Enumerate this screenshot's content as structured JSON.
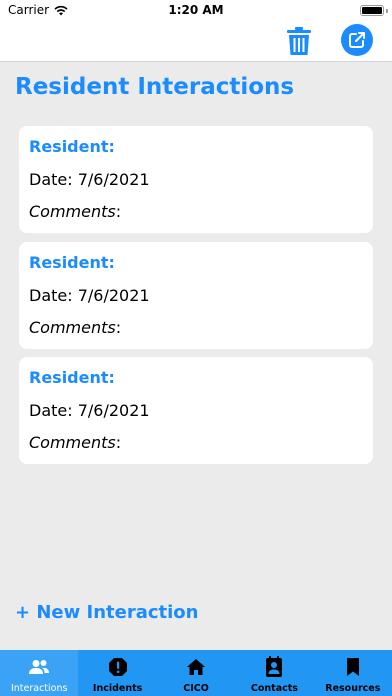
{
  "status_bar": {
    "carrier": "Carrier",
    "time": "1:20 AM"
  },
  "nav": {
    "trash_icon": "trash-icon",
    "share_icon": "share-edit-icon"
  },
  "page": {
    "title": "Resident Interactions"
  },
  "interactions": [
    {
      "resident_label": "Resident:",
      "date_label": "Date: 7/6/2021",
      "comments_label": "Comments",
      "comments_suffix": ":"
    },
    {
      "resident_label": "Resident:",
      "date_label": "Date: 7/6/2021",
      "comments_label": "Comments",
      "comments_suffix": ":"
    },
    {
      "resident_label": "Resident:",
      "date_label": "Date: 7/6/2021",
      "comments_label": "Comments",
      "comments_suffix": ":"
    }
  ],
  "new_interaction_label": "+ New Interaction",
  "tabs": [
    {
      "label": "Interactions",
      "icon": "people-icon",
      "active": true
    },
    {
      "label": "Incidents",
      "icon": "alert-icon",
      "active": false
    },
    {
      "label": "CICO",
      "icon": "home-icon",
      "active": false
    },
    {
      "label": "Contacts",
      "icon": "contact-book-icon",
      "active": false
    },
    {
      "label": "Resources",
      "icon": "bookmark-icon",
      "active": false
    }
  ],
  "colors": {
    "accent": "#1a8cff",
    "tab_bar": "#2196f3",
    "background": "#ebebeb"
  }
}
